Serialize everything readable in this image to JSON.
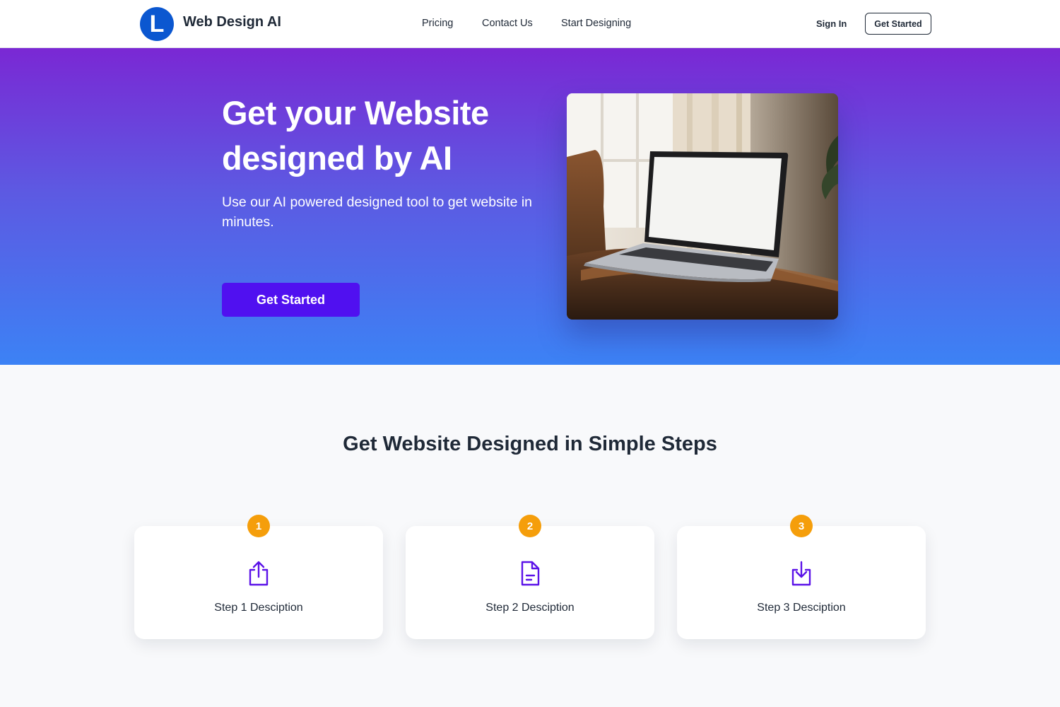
{
  "header": {
    "logo_letter": "L",
    "brand": "Web Design AI",
    "nav": [
      "Pricing",
      "Contact Us",
      "Start Designing"
    ],
    "sign_in": "Sign In",
    "get_started": "Get Started"
  },
  "hero": {
    "title": "Get your Website designed by AI",
    "subtitle": "Use our AI powered designed tool to get website in minutes.",
    "cta": "Get Started",
    "image_icon": "laptop-photo"
  },
  "steps": {
    "title": "Get Website Designed in Simple Steps",
    "items": [
      {
        "number": "1",
        "label": "Step 1 Desciption",
        "icon": "upload-icon"
      },
      {
        "number": "2",
        "label": "Step 2 Desciption",
        "icon": "document-icon"
      },
      {
        "number": "3",
        "label": "Step 3 Desciption",
        "icon": "download-icon"
      }
    ]
  },
  "colors": {
    "brand_blue": "#0b57d0",
    "cta_purple": "#5010f0",
    "badge_orange": "#f59e0b",
    "icon_purple": "#5b12e8"
  }
}
